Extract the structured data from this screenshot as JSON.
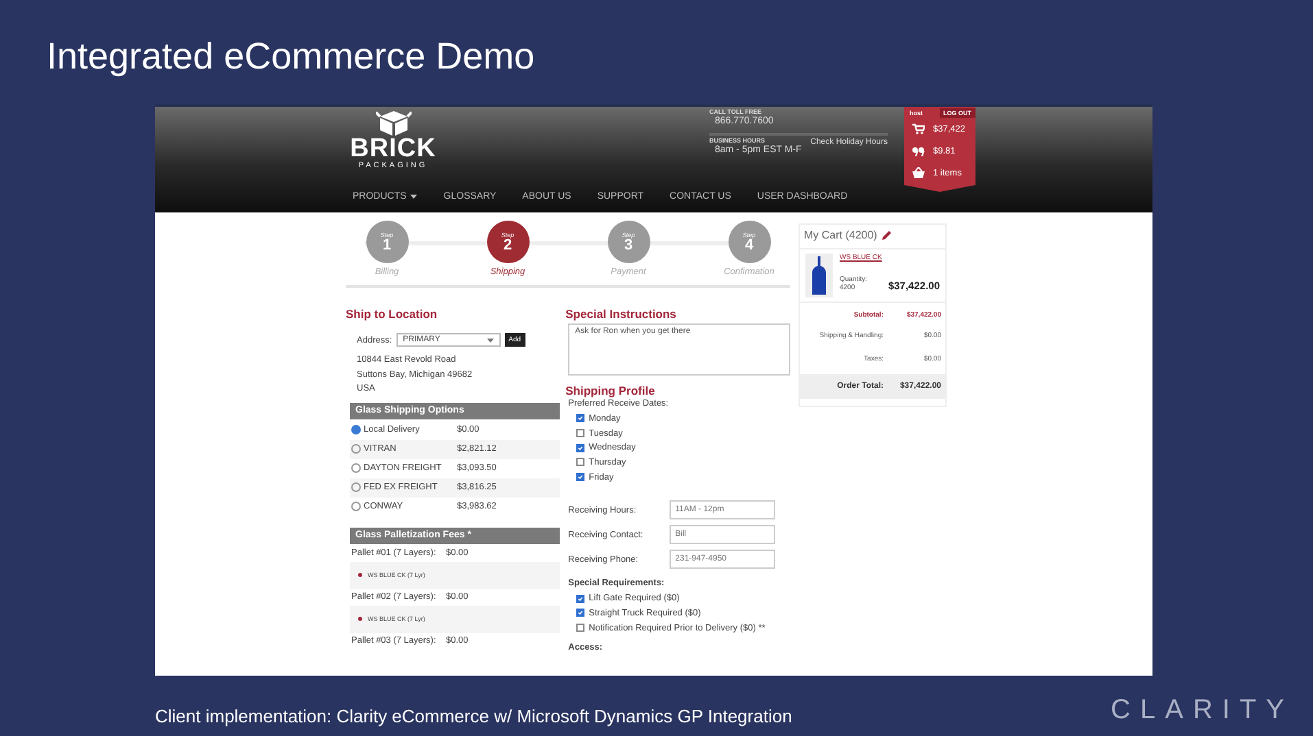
{
  "slide_title": "Integrated eCommerce Demo",
  "site": {
    "logo": {
      "name": "BRICK",
      "tagline": "PACKAGING"
    },
    "contact": {
      "toll_label": "CALL TOLL FREE",
      "phone": "866.770.7600",
      "hours_label": "BUSINESS HOURS",
      "hours": "8am - 5pm EST M-F",
      "holiday_link": "Check Holiday Hours"
    },
    "account": {
      "user": "host",
      "logout": "LOG OUT",
      "cart_total": "$37,422",
      "quote_total": "$9.81",
      "items": "1 items"
    },
    "nav": [
      {
        "label": "PRODUCTS",
        "dropdown": true
      },
      {
        "label": "GLOSSARY",
        "dropdown": false
      },
      {
        "label": "ABOUT US",
        "dropdown": false
      },
      {
        "label": "SUPPORT",
        "dropdown": false
      },
      {
        "label": "CONTACT US",
        "dropdown": false
      },
      {
        "label": "USER DASHBOARD",
        "dropdown": false
      }
    ],
    "steps": [
      {
        "word": "Step",
        "number": "1",
        "label": "Billing",
        "selected": false
      },
      {
        "word": "Step",
        "number": "2",
        "label": "Shipping",
        "selected": true
      },
      {
        "word": "Step",
        "number": "3",
        "label": "Payment",
        "selected": false
      },
      {
        "word": "Step",
        "number": "4",
        "label": "Confirmation",
        "selected": false
      }
    ],
    "ship_to": {
      "title": "Ship to Location",
      "address_label": "Address:",
      "address_value": "PRIMARY",
      "add_button": "Add",
      "address_lines": [
        "10844 East Revold Road",
        "Suttons Bay, Michigan 49682",
        "USA"
      ]
    },
    "shipping_options": {
      "title": "Glass Shipping Options",
      "options": [
        {
          "name": "Local Delivery",
          "price": "$0.00",
          "selected": true
        },
        {
          "name": "VITRAN",
          "price": "$2,821.12",
          "selected": false
        },
        {
          "name": "DAYTON FREIGHT",
          "price": "$3,093.50",
          "selected": false
        },
        {
          "name": "FED EX FREIGHT",
          "price": "$3,816.25",
          "selected": false
        },
        {
          "name": "CONWAY",
          "price": "$3,983.62",
          "selected": false
        }
      ]
    },
    "palletization": {
      "title": "Glass Palletization Fees *",
      "pallets": [
        {
          "label": "Pallet #01 (7 Layers):",
          "price": "$0.00",
          "item": "WS BLUE CK (7 Lyr)",
          "color": "#a3263a"
        },
        {
          "label": "Pallet #02 (7 Layers):",
          "price": "$0.00",
          "item": "WS BLUE CK (7 Lyr)",
          "color": "#a3263a"
        },
        {
          "label": "Pallet #03 (7 Layers):",
          "price": "$0.00"
        }
      ]
    },
    "instructions": {
      "title": "Special Instructions",
      "value": "Ask for Ron when you get there"
    },
    "profile": {
      "title": "Shipping Profile",
      "dates_label": "Preferred Receive Dates:",
      "days": [
        {
          "label": "Monday",
          "checked": true
        },
        {
          "label": "Tuesday",
          "checked": false
        },
        {
          "label": "Wednesday",
          "checked": true
        },
        {
          "label": "Thursday",
          "checked": false
        },
        {
          "label": "Friday",
          "checked": true
        }
      ],
      "fields": [
        {
          "label": "Receiving Hours:",
          "value": "11AM - 12pm"
        },
        {
          "label": "Receiving Contact:",
          "value": "Bill"
        },
        {
          "label": "Receiving Phone:",
          "value": "231-947-4950"
        }
      ],
      "requirements_label": "Special Requirements:",
      "requirements": [
        {
          "label": "Lift Gate Required ($0)",
          "checked": true
        },
        {
          "label": "Straight Truck Required ($0)",
          "checked": true
        },
        {
          "label": "Notification Required Prior to Delivery ($0) **",
          "checked": false
        }
      ],
      "access_label": "Access:"
    },
    "cart": {
      "title": "My Cart (4200)",
      "item": {
        "name": "WS BLUE CK",
        "quantity_label": "Quantity:",
        "quantity": "4200",
        "price": "$37,422.00"
      },
      "subtotal_label": "Subtotal:",
      "subtotal": "$37,422.00",
      "shipping_label": "Shipping & Handling:",
      "shipping": "$0.00",
      "taxes_label": "Taxes:",
      "taxes": "$0.00",
      "total_label": "Order Total:",
      "total": "$37,422.00"
    }
  },
  "caption": "Client implementation: Clarity eCommerce w/ Microsoft Dynamics GP Integration",
  "brand": "CLARITY"
}
